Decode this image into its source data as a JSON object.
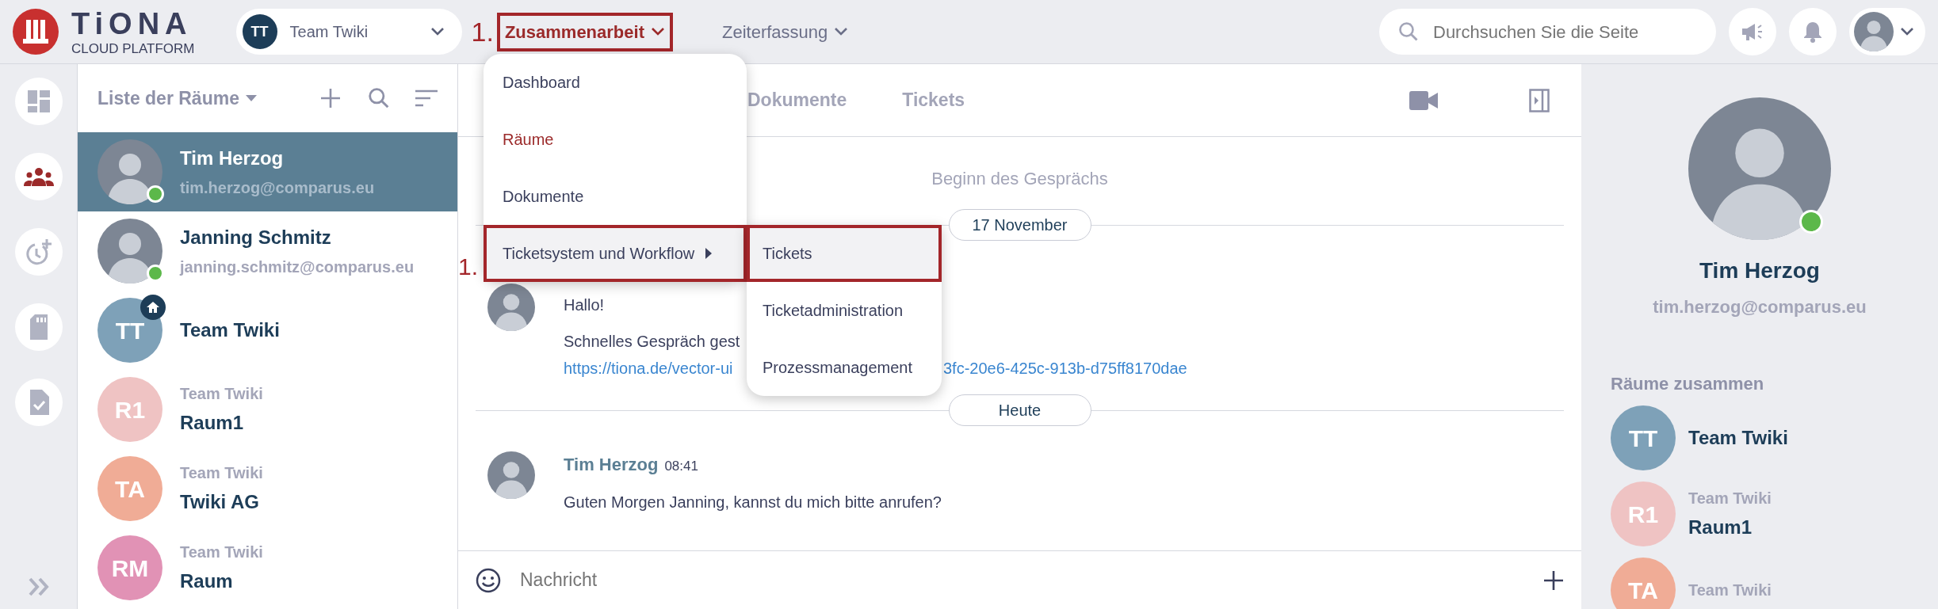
{
  "header": {
    "logo": {
      "title": "TiONA",
      "subtitle": "CLOUD PLATFORM"
    },
    "team_selector": {
      "initials": "TT",
      "label": "Team Twiki"
    },
    "nav": [
      {
        "label": "Zusammenarbeit",
        "selected": true,
        "marked": true,
        "annotation": "1."
      },
      {
        "label": "Zeiterfassung",
        "selected": false,
        "marked": false
      }
    ],
    "search": {
      "placeholder": "Durchsuchen Sie die Seite"
    }
  },
  "rail": {
    "items": [
      {
        "kind": "dashboard",
        "selected": false
      },
      {
        "kind": "people",
        "selected": true
      },
      {
        "kind": "clock",
        "selected": false
      },
      {
        "kind": "card",
        "selected": false
      },
      {
        "kind": "document",
        "selected": false
      }
    ]
  },
  "room_list": {
    "title": "Liste der Räume",
    "rooms": [
      {
        "kind": "person",
        "name": "Tim Herzog",
        "subtitle": "tim.herzog@comparus.eu",
        "online": true,
        "selected": true
      },
      {
        "kind": "person",
        "name": "Janning Schmitz",
        "subtitle": "janning.schmitz@comparus.eu",
        "online": true,
        "selected": false
      },
      {
        "kind": "team",
        "initials": "TT",
        "name": "Team Twiki",
        "color": "#7ea1b8",
        "home": true,
        "selected": false
      },
      {
        "kind": "room",
        "initials": "R1",
        "team": "Team Twiki",
        "name": "Raum1",
        "color": "#efc3c3",
        "selected": false
      },
      {
        "kind": "room",
        "initials": "TA",
        "team": "Team Twiki",
        "name": "Twiki AG",
        "color": "#f0ac96",
        "selected": false
      },
      {
        "kind": "room",
        "initials": "RM",
        "team": "Team Twiki",
        "name": "Raum",
        "color": "#e192b5",
        "selected": false
      }
    ]
  },
  "chat": {
    "tabs": [
      {
        "label": "Dokumente",
        "selected": false
      },
      {
        "label": "Tickets",
        "selected": false
      }
    ],
    "start_note": "Beginn des Gesprächs",
    "timeline": [
      {
        "kind": "date",
        "label": "17 November"
      },
      {
        "kind": "message",
        "lines": [
          "Hallo!",
          "Schnelles Gespräch gest"
        ],
        "link_parts": [
          "https://tiona.de/vector-ui",
          "3fc-20e6-425c-913b-d75ff8170dae"
        ]
      },
      {
        "kind": "date",
        "label": "Heute"
      },
      {
        "kind": "message",
        "author": "Tim Herzog",
        "time": "08:41",
        "lines": [
          "Guten Morgen Janning, kannst du mich bitte anrufen?"
        ]
      }
    ],
    "composer": {
      "placeholder": "Nachricht"
    }
  },
  "menu": {
    "items": [
      {
        "label": "Dashboard",
        "selected": false,
        "highlighted": false,
        "marked": false,
        "submenu": false
      },
      {
        "label": "Räume",
        "selected": true,
        "highlighted": false,
        "marked": false,
        "submenu": false
      },
      {
        "label": "Dokumente",
        "selected": false,
        "highlighted": false,
        "marked": false,
        "submenu": false
      },
      {
        "label": "Ticketsystem und Workflow",
        "selected": false,
        "highlighted": true,
        "marked": true,
        "submenu": true,
        "annotation": "1."
      }
    ],
    "submenu": [
      {
        "label": "Tickets",
        "highlighted": true,
        "marked": true
      },
      {
        "label": "Ticketadministration",
        "highlighted": false,
        "marked": false
      },
      {
        "label": "Prozessmanagement",
        "highlighted": false,
        "marked": false
      }
    ]
  },
  "profile": {
    "name": "Tim Herzog",
    "email": "tim.herzog@comparus.eu",
    "online": true,
    "shared_title": "Räume zusammen",
    "rooms": [
      {
        "initials": "TT",
        "name": "Team Twiki",
        "color": "#7ea1b8"
      },
      {
        "initials": "R1",
        "team": "Team Twiki",
        "name": "Raum1",
        "color": "#efc3c3"
      },
      {
        "initials": "TA",
        "team": "Team Twiki",
        "color": "#f0ac96"
      }
    ]
  }
}
